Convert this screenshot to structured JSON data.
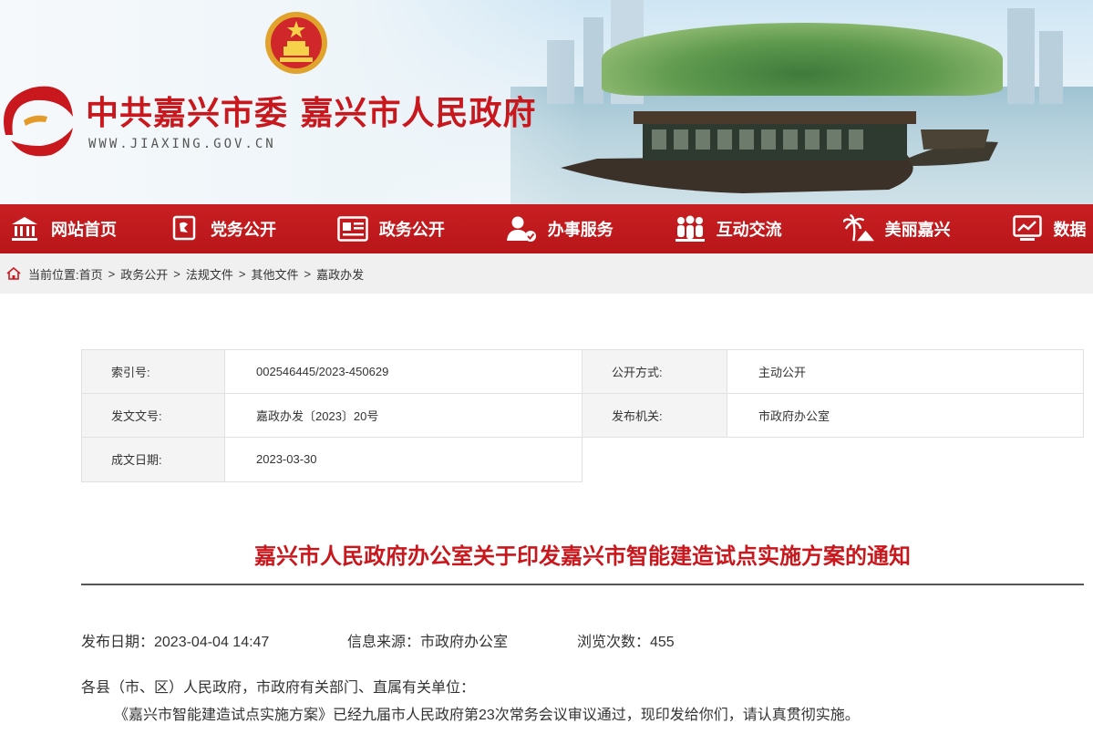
{
  "header": {
    "title": "中共嘉兴市委 嘉兴市人民政府",
    "url": "WWW.JIAXING.GOV.CN",
    "brand_red": "#c8181d"
  },
  "nav": {
    "items": [
      {
        "label": "网站首页",
        "icon": "bank-icon"
      },
      {
        "label": "党务公开",
        "icon": "party-flag-icon"
      },
      {
        "label": "政务公开",
        "icon": "document-list-icon"
      },
      {
        "label": "办事服务",
        "icon": "user-service-icon"
      },
      {
        "label": "互动交流",
        "icon": "people-group-icon"
      },
      {
        "label": "美丽嘉兴",
        "icon": "palm-scenery-icon"
      },
      {
        "label": "数据",
        "icon": "data-screen-icon"
      }
    ]
  },
  "breadcrumb": {
    "prefix": "当前位置:",
    "items": [
      "首页",
      "政务公开",
      "法规文件",
      "其他文件",
      "嘉政办发"
    ],
    "separator": ">"
  },
  "info_table": {
    "index_label": "索引号:",
    "index_value": "002546445/2023-450629",
    "open_label": "公开方式:",
    "open_value": "主动公开",
    "doc_no_label": "发文文号:",
    "doc_no_value": "嘉政办发〔2023〕20号",
    "issuer_label": "发布机关:",
    "issuer_value": "市政府办公室",
    "date_label": "成文日期:",
    "date_value": "2023-03-30"
  },
  "article": {
    "title": "嘉兴市人民政府办公室关于印发嘉兴市智能建造试点实施方案的通知",
    "publish_date": "发布日期：2023-04-04 14:47",
    "source": "信息来源：市政府办公室",
    "views": "浏览次数：455",
    "salutation": "各县（市、区）人民政府，市政府有关部门、直属有关单位：",
    "paragraph1": "《嘉兴市智能建造试点实施方案》已经九届市人民政府第23次常务会议审议通过，现印发给你们，请认真贯彻实施。"
  }
}
